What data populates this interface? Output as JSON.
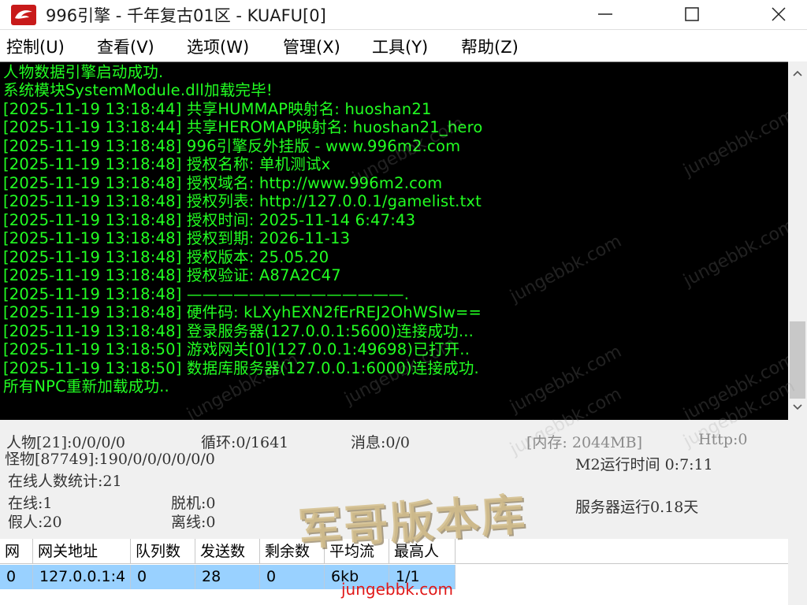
{
  "window": {
    "title": "996引擎 - 千年复古01区 - KUAFU[0]"
  },
  "menu": [
    "控制(U)",
    "查看(V)",
    "选项(W)",
    "管理(X)",
    "工具(Y)",
    "帮助(Z)"
  ],
  "log": [
    "人物数据引擎启动成功.",
    "系统模块SystemModule.dll加载完毕!",
    "[2025-11-19 13:18:44] 共享HUMMAP映射名: huoshan21",
    "[2025-11-19 13:18:44] 共享HEROMAP映射名: huoshan21_hero",
    "[2025-11-19 13:18:48] 996引擎反外挂版 - www.996m2.com",
    "[2025-11-19 13:18:48] 授权名称: 单机测试x",
    "[2025-11-19 13:18:48] 授权域名: http://www.996m2.com",
    "[2025-11-19 13:18:48] 授权列表: http://127.0.0.1/gamelist.txt",
    "[2025-11-19 13:18:48] 授权时间: 2025-11-14 6:47:43",
    "[2025-11-19 13:18:48] 授权到期: 2026-11-13",
    "[2025-11-19 13:18:48] 授权版本: 25.05.20",
    "[2025-11-19 13:18:48] 授权验证: A87A2C47",
    "[2025-11-19 13:18:48] ——————————————.",
    "[2025-11-19 13:18:48] 硬件码: kLXyhEXN2fErREJ2OhWSIw==",
    "[2025-11-19 13:18:48] 登录服务器(127.0.0.1:5600)连接成功...",
    "[2025-11-19 13:18:50] 游戏网关[0](127.0.0.1:49698)已打开..",
    "[2025-11-19 13:18:50] 数据库服务器(127.0.0.1:6000)连接成功.",
    "所有NPC重新加载成功.."
  ],
  "status": {
    "players": "人物[21]:0/0/0/0",
    "loop": "循环:0/1641",
    "message": "消息:0/0",
    "memory": "[内存: 2044MB]",
    "http": "Http:0",
    "monsters": "怪物[87749]:190/0/0/0/0/0/0",
    "m2_runtime": "M2运行时间 0:7:11",
    "online_stats": "在线人数统计:21",
    "online": "在线:1",
    "offline_bot": "脱机:0",
    "fake": "假人:20",
    "disconnected": "离线:0",
    "server_runtime": "服务器运行0.18天"
  },
  "gateway_table": {
    "headers": [
      "网",
      "网关地址",
      "队列数",
      "发送数",
      "剩余数",
      "平均流",
      "最高人"
    ],
    "rows": [
      [
        "0",
        "127.0.0.1:4",
        "0",
        "28",
        "0",
        "6kb",
        "1/1"
      ]
    ]
  },
  "watermark": {
    "text": "jungebbk.com",
    "logo_text": "军哥版本库",
    "site": "jungebbk.com"
  },
  "colors": {
    "console_bg": "#000000",
    "console_text": "#22ff22",
    "selected_row": "#99d1ff",
    "site_link": "#e01818"
  }
}
